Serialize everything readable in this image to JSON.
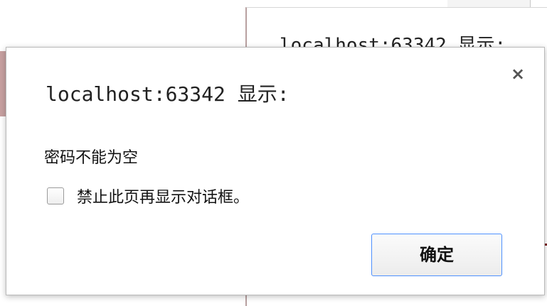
{
  "background_dialog": {
    "title": "localhost:63342 显示:"
  },
  "dialog": {
    "title": "localhost:63342 显示:",
    "close_glyph": "×",
    "message": "密码不能为空",
    "suppress_checkbox": {
      "label": "禁止此页再显示对话框。",
      "checked": false
    },
    "ok_button_label": "确定"
  },
  "colors": {
    "focus_border": "#4d90fe",
    "accent_dark_red": "#7d1f1f"
  },
  "icons": {
    "close": "close-icon"
  }
}
